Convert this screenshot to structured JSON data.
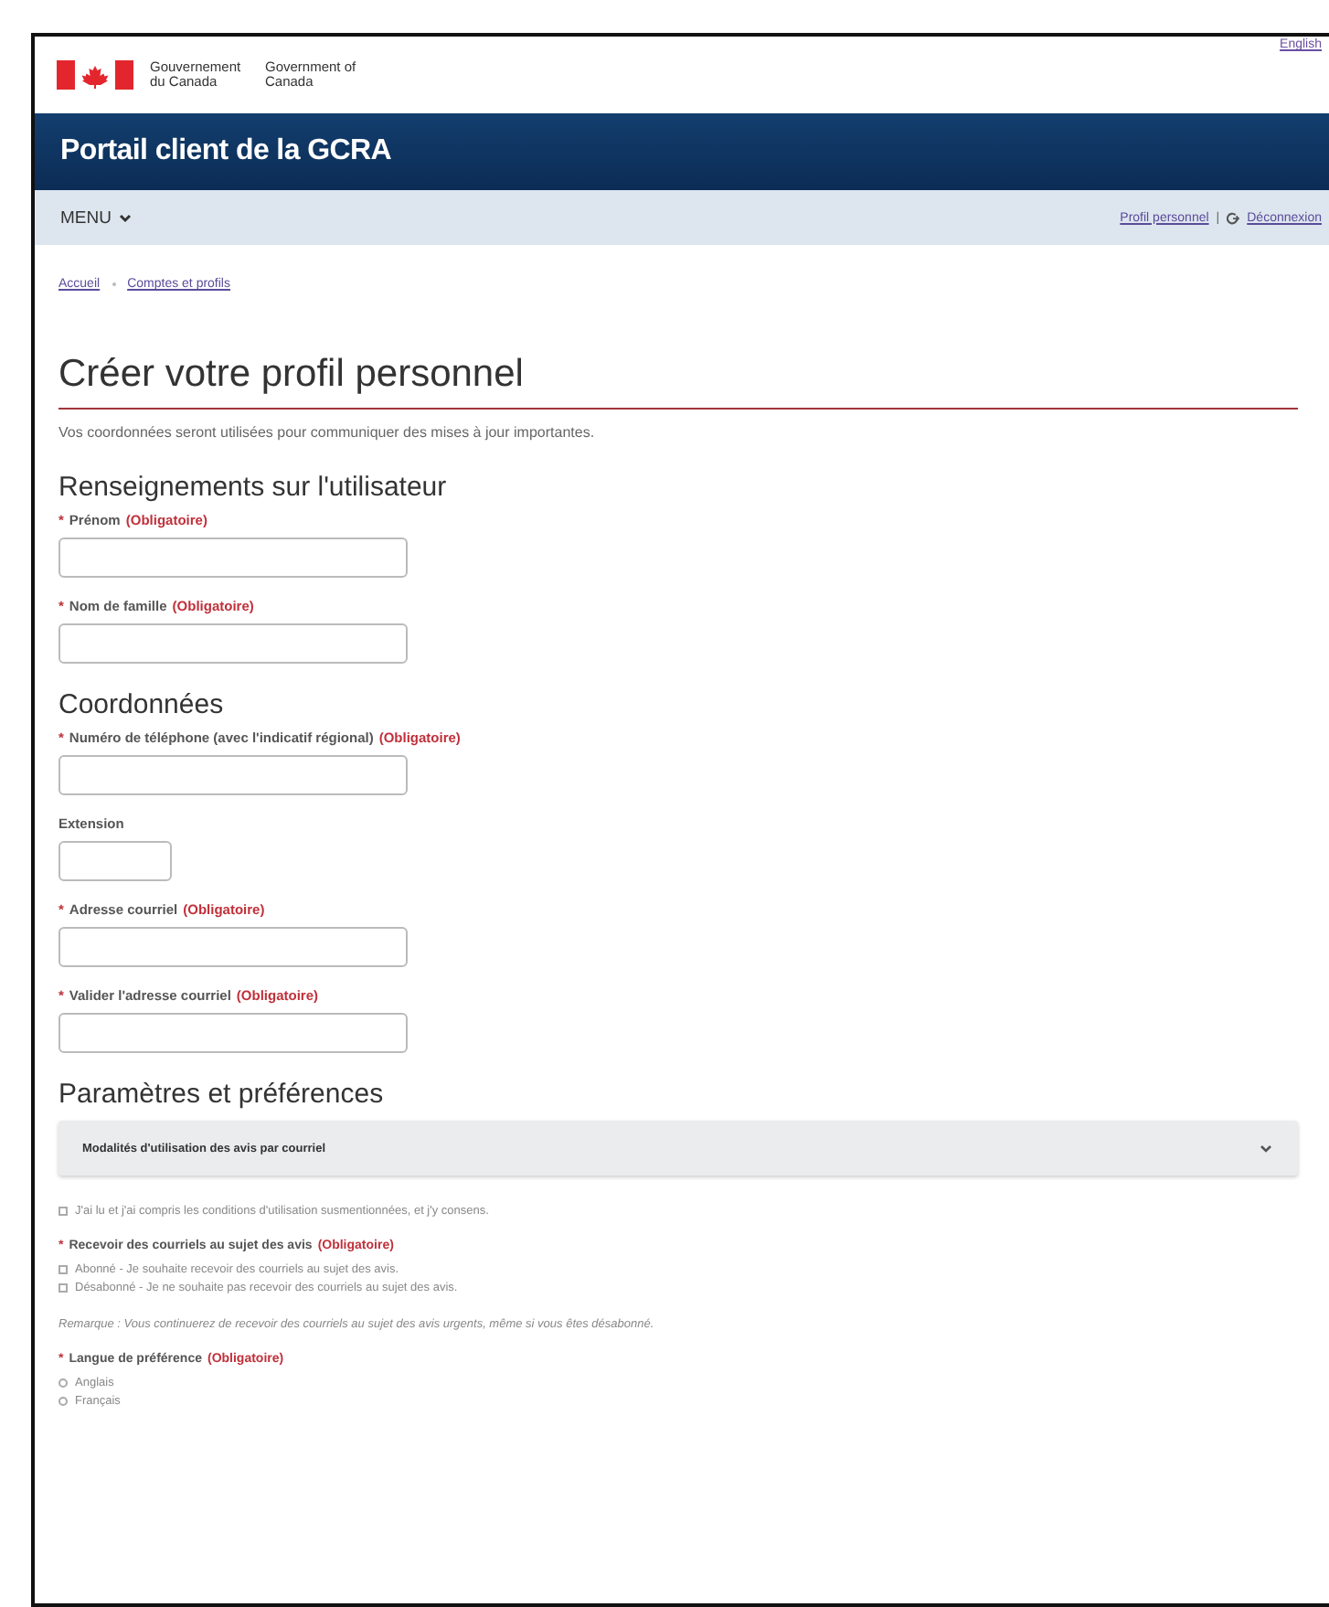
{
  "header": {
    "gov_fr": "Gouvernement du Canada",
    "gov_en": "Government of Canada",
    "language_link": "English"
  },
  "app_bar": {
    "title": "Portail client de la GCRA"
  },
  "menu_bar": {
    "menu": "MENU",
    "profile_link": "Profil personnel",
    "separator": "|",
    "logout_link": "Déconnexion"
  },
  "breadcrumb": [
    "Accueil",
    "Comptes et profils"
  ],
  "page": {
    "title": "Créer votre profil personnel",
    "intro": "Vos coordonnées seront utilisées pour communiquer des mises à jour importantes."
  },
  "sections": [
    {
      "heading": "Renseignements sur l'utilisateur",
      "fields": [
        {
          "marker": "*",
          "label": "Prénom",
          "required_text": "(Obligatoire)",
          "kind": "long"
        },
        {
          "marker": "*",
          "label": "Nom de famille",
          "required_text": "(Obligatoire)",
          "kind": "long"
        }
      ]
    },
    {
      "heading": "Coordonnées",
      "fields": [
        {
          "marker": "*",
          "label": "Numéro de téléphone (avec l'indicatif régional)",
          "required_text": "(Obligatoire)",
          "kind": "long"
        },
        {
          "label": "Extension",
          "kind": "short"
        },
        {
          "marker": "*",
          "label": "Adresse courriel",
          "required_text": "(Obligatoire)",
          "kind": "long"
        },
        {
          "marker": "*",
          "label": "Valider l'adresse courriel",
          "required_text": "(Obligatoire)",
          "kind": "long"
        }
      ]
    }
  ],
  "preferences": {
    "heading": "Paramètres et préférences",
    "accordion": {
      "title": "Modalités d'utilisation des avis par courriel",
      "expanded": false
    },
    "consent": {
      "label": "J'ai lu et j'ai compris les conditions d'utilisation susmentionnées, et j'y consens.",
      "checked": false
    },
    "email_notices": {
      "marker": "*",
      "label": "Recevoir des courriels au sujet des avis",
      "required_text": "(Obligatoire)",
      "options": [
        {
          "label": "Abonné - Je souhaite recevoir des courriels au sujet des avis.",
          "selected": false
        },
        {
          "label": "Désabonné - Je ne souhaite pas recevoir des courriels au sujet des avis.",
          "selected": false
        }
      ]
    },
    "note": "Remarque : Vous continuerez de recevoir des courriels au sujet des avis urgents, même si vous êtes désabonné.",
    "language": {
      "marker": "*",
      "label": "Langue de préférence",
      "required_text": "(Obligatoire)",
      "options": [
        {
          "label": "Anglais",
          "selected": false
        },
        {
          "label": "Français",
          "selected": false
        }
      ]
    }
  }
}
